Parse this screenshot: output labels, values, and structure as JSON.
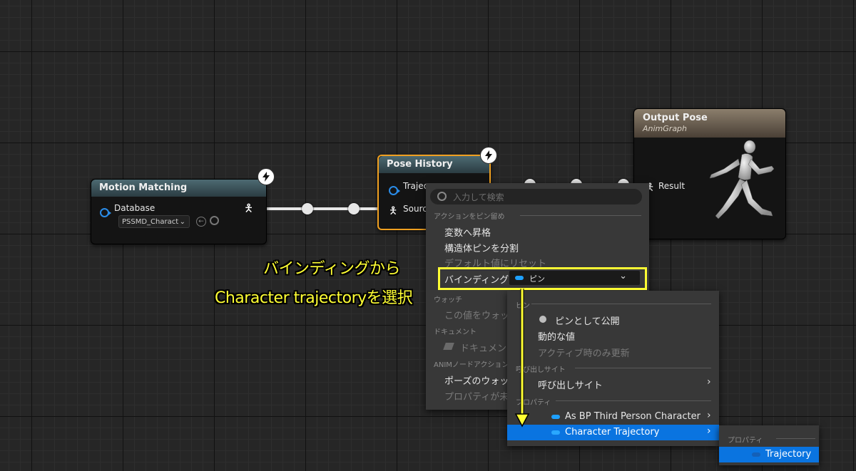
{
  "nodes": {
    "motion_matching": {
      "title": "Motion Matching",
      "pin_database": "Database",
      "database_value": "PSSMD_Charact"
    },
    "pose_history": {
      "title": "Pose History",
      "pin_trajectory": "Trajec",
      "pin_source": "Sourc"
    },
    "output_pose": {
      "title": "Output Pose",
      "subtitle": "AnimGraph",
      "pin_result": "Result"
    }
  },
  "context_menu": {
    "search_placeholder": "入力して検索",
    "sections": {
      "pin_actions": "アクションをピン留め",
      "watch": "ウォッチ",
      "documentation": "ドキュメント",
      "anim_node_actions": "ANIMノードアクション"
    },
    "items": {
      "promote_variable": "変数へ昇格",
      "split_struct": "構造体ピンを分割",
      "reset_default": "デフォルト値にリセット",
      "binding_label": "バインディング",
      "binding_value": "ピン",
      "watch_value": "この値をウォッチ",
      "document": "ドキュメント",
      "pose_watch": "ポーズのウォッ",
      "property_binding": "プロパティが未"
    }
  },
  "binding_menu": {
    "sections": {
      "pin": "ピン",
      "call_site": "呼び出しサイト",
      "property": "プロパティ"
    },
    "items": {
      "expose_as_pin": "ピンとして公開",
      "dynamic_value": "動的な値",
      "active_only": "アクティブ時のみ更新",
      "call_site": "呼び出しサイト",
      "as_bp_third_person": "As BP Third Person Character",
      "character_trajectory": "Character Trajectory"
    }
  },
  "sub_menu": {
    "section": "プロパティ",
    "item": "Trajectory"
  },
  "annotation": {
    "line1": "バインディングから",
    "line2": "Character trajectoryを選択"
  },
  "colors": {
    "highlight": "#0a74e0",
    "annotation": "#ffff33",
    "pose_history_border": "#f0a020"
  }
}
